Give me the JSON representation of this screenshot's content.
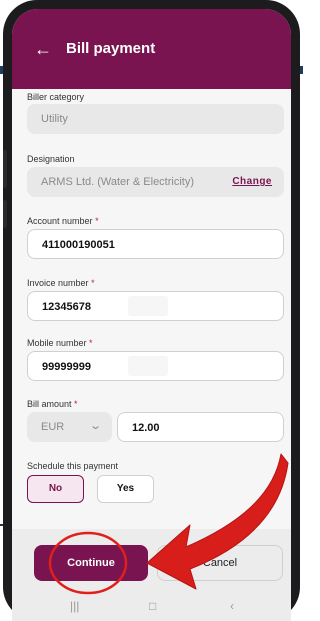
{
  "header": {
    "back_icon": "arrow-left-icon",
    "title": "Bill payment"
  },
  "form": {
    "biller_category": {
      "label": "Biller category",
      "value": "Utility"
    },
    "designation": {
      "label": "Designation",
      "value": "ARMS Ltd. (Water & Electricity)",
      "change_label": "Change"
    },
    "account_number": {
      "label": "Account number",
      "required": "*",
      "value": "411000190051"
    },
    "invoice_number": {
      "label": "Invoice number",
      "required": "*",
      "value": "12345678"
    },
    "mobile_number": {
      "label": "Mobile number",
      "required": "*",
      "value": "99999999"
    },
    "bill_amount": {
      "label": "Bill amount",
      "required": "*",
      "currency": "EUR",
      "value": "12.00"
    },
    "schedule": {
      "label": "Schedule this payment",
      "no_label": "No",
      "yes_label": "Yes",
      "selected": "No"
    }
  },
  "actions": {
    "continue_label": "Continue",
    "cancel_label": "Cancel"
  },
  "colors": {
    "brand": "#7a1450",
    "annotation": "#e0201b"
  }
}
